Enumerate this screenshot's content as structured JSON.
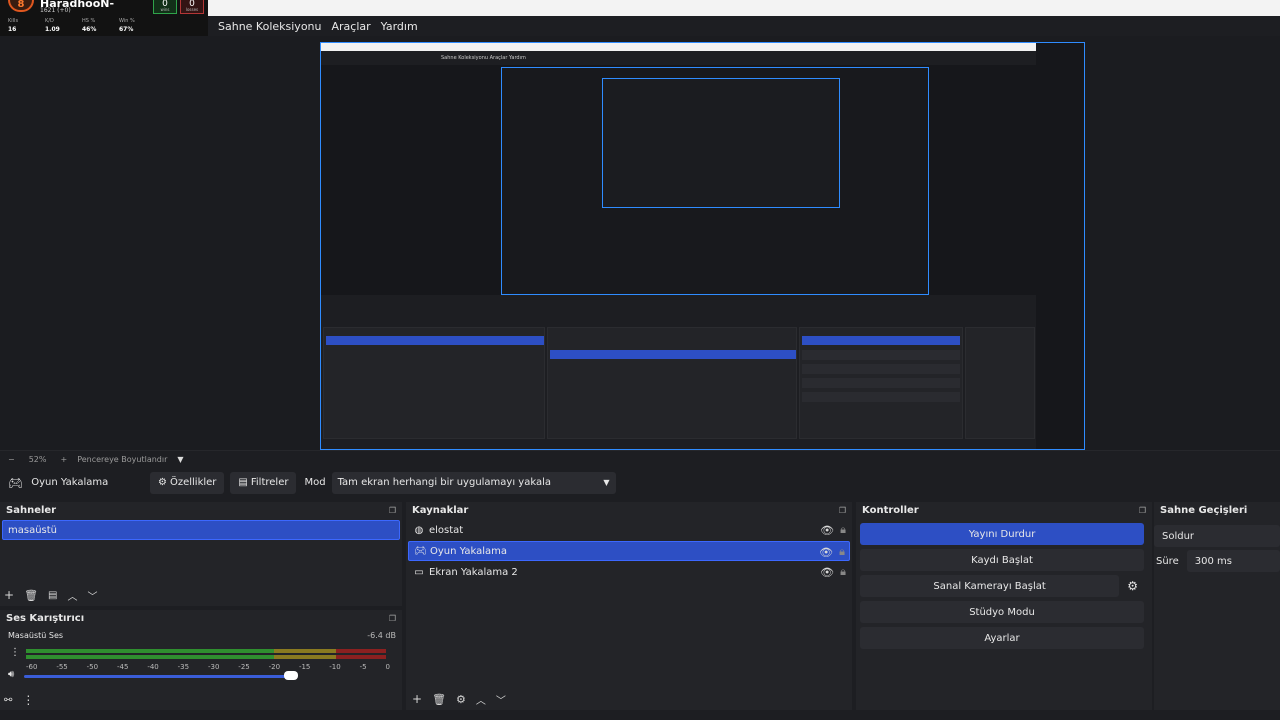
{
  "overlay": {
    "badge": "8",
    "name": "HaradhooN-",
    "sub": "1621 (+0)",
    "stats": [
      {
        "label": "Kills",
        "value": "16"
      },
      {
        "label": "K/D",
        "value": "1.09"
      },
      {
        "label": "HS %",
        "value": "46%"
      },
      {
        "label": "Win %",
        "value": "67%"
      }
    ],
    "wins": {
      "value": "0",
      "label": "wins"
    },
    "losses": {
      "value": "0",
      "label": "losses"
    }
  },
  "menubar": [
    "Sahne Koleksiyonu",
    "Araçlar",
    "Yardım"
  ],
  "preview": {
    "menu": "Sahne Koleksiyonu   Araçlar   Yardım"
  },
  "zoombar": {
    "minus": "−",
    "zoom": "52%",
    "plus": "+",
    "mode": "Pencereye Boyutlandır",
    "arrow": "▼"
  },
  "source_toolbar": {
    "source_name": "Oyun Yakalama",
    "properties": "Özellikler",
    "filters": "Filtreler",
    "mode_label": "Mod",
    "mode_value": "Tam ekran herhangi bir uygulamayı yakala"
  },
  "scenes": {
    "title": "Sahneler",
    "items": [
      "masaüstü"
    ]
  },
  "mixer": {
    "title": "Ses Karıştırıcı",
    "channel": "Masaüstü Ses",
    "level": "-6.4 dB",
    "ticks": [
      "-60",
      "-55",
      "-50",
      "-45",
      "-40",
      "-35",
      "-30",
      "-25",
      "-20",
      "-15",
      "-10",
      "-5",
      "0"
    ]
  },
  "sources": {
    "title": "Kaynaklar",
    "items": [
      {
        "label": "elostat",
        "icon": "globe-icon"
      },
      {
        "label": "Oyun Yakalama",
        "icon": "gamepad-icon"
      },
      {
        "label": "Ekran Yakalama 2",
        "icon": "monitor-icon"
      }
    ]
  },
  "controls": {
    "title": "Kontroller",
    "buttons": [
      "Yayını Durdur",
      "Kaydı Başlat",
      "Sanal Kamerayı Başlat",
      "Stüdyo Modu",
      "Ayarlar"
    ]
  },
  "transitions": {
    "title": "Sahne Geçişleri",
    "type": "Soldur",
    "duration_label": "Süre",
    "duration_value": "300 ms"
  },
  "colors": {
    "accent": "#2d4fc4",
    "selection_border": "#3c68ff",
    "preview_border": "#2f8cff"
  }
}
